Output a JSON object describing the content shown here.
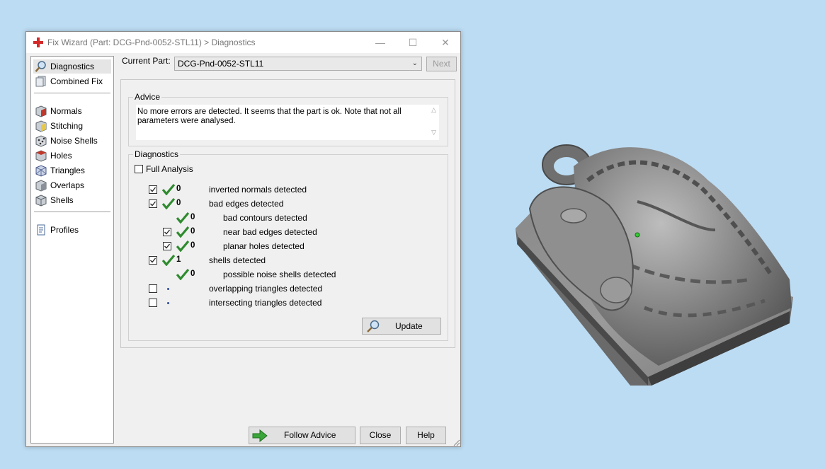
{
  "window": {
    "title": "Fix Wizard (Part: DCG-Pnd-0052-STL11) > Diagnostics",
    "minimize": "—",
    "maximize": "☐",
    "close": "✕"
  },
  "sidebar": {
    "items": [
      {
        "label": "Diagnostics",
        "icon": "magnifier-icon"
      },
      {
        "label": "Combined Fix",
        "icon": "combined-fix-icon"
      },
      {
        "label": "Normals",
        "icon": "normals-cube-icon"
      },
      {
        "label": "Stitching",
        "icon": "stitching-cube-icon"
      },
      {
        "label": "Noise Shells",
        "icon": "noise-shells-icon"
      },
      {
        "label": "Holes",
        "icon": "holes-cube-icon"
      },
      {
        "label": "Triangles",
        "icon": "triangles-cube-icon"
      },
      {
        "label": "Overlaps",
        "icon": "overlaps-cube-icon"
      },
      {
        "label": "Shells",
        "icon": "shells-cube-icon"
      },
      {
        "label": "Profiles",
        "icon": "profiles-document-icon"
      }
    ]
  },
  "current_part": {
    "label": "Current Part:",
    "value": "DCG-Pnd-0052-STL11",
    "next_label": "Next"
  },
  "advice": {
    "title": "Advice",
    "text": "No more errors are detected. It seems that the part is ok. Note that not all parameters were analysed."
  },
  "diagnostics": {
    "title": "Diagnostics",
    "full_analysis_label": "Full Analysis",
    "rows": [
      {
        "count": "0",
        "label": "inverted normals detected"
      },
      {
        "count": "0",
        "label": "bad edges detected"
      },
      {
        "count": "0",
        "label": "bad contours detected"
      },
      {
        "count": "0",
        "label": "near bad edges detected"
      },
      {
        "count": "0",
        "label": "planar holes detected"
      },
      {
        "count": "1",
        "label": "shells detected"
      },
      {
        "count": "0",
        "label": "possible noise shells detected"
      },
      {
        "count": "",
        "label": "overlapping triangles detected"
      },
      {
        "count": "",
        "label": "intersecting triangles detected"
      }
    ],
    "update_label": "Update"
  },
  "footer": {
    "follow_advice": "Follow Advice",
    "close": "Close",
    "help": "Help"
  },
  "colors": {
    "desktop": "#bcdcf3",
    "check_green": "#2e8b2e",
    "app_red": "#d42a2a"
  }
}
